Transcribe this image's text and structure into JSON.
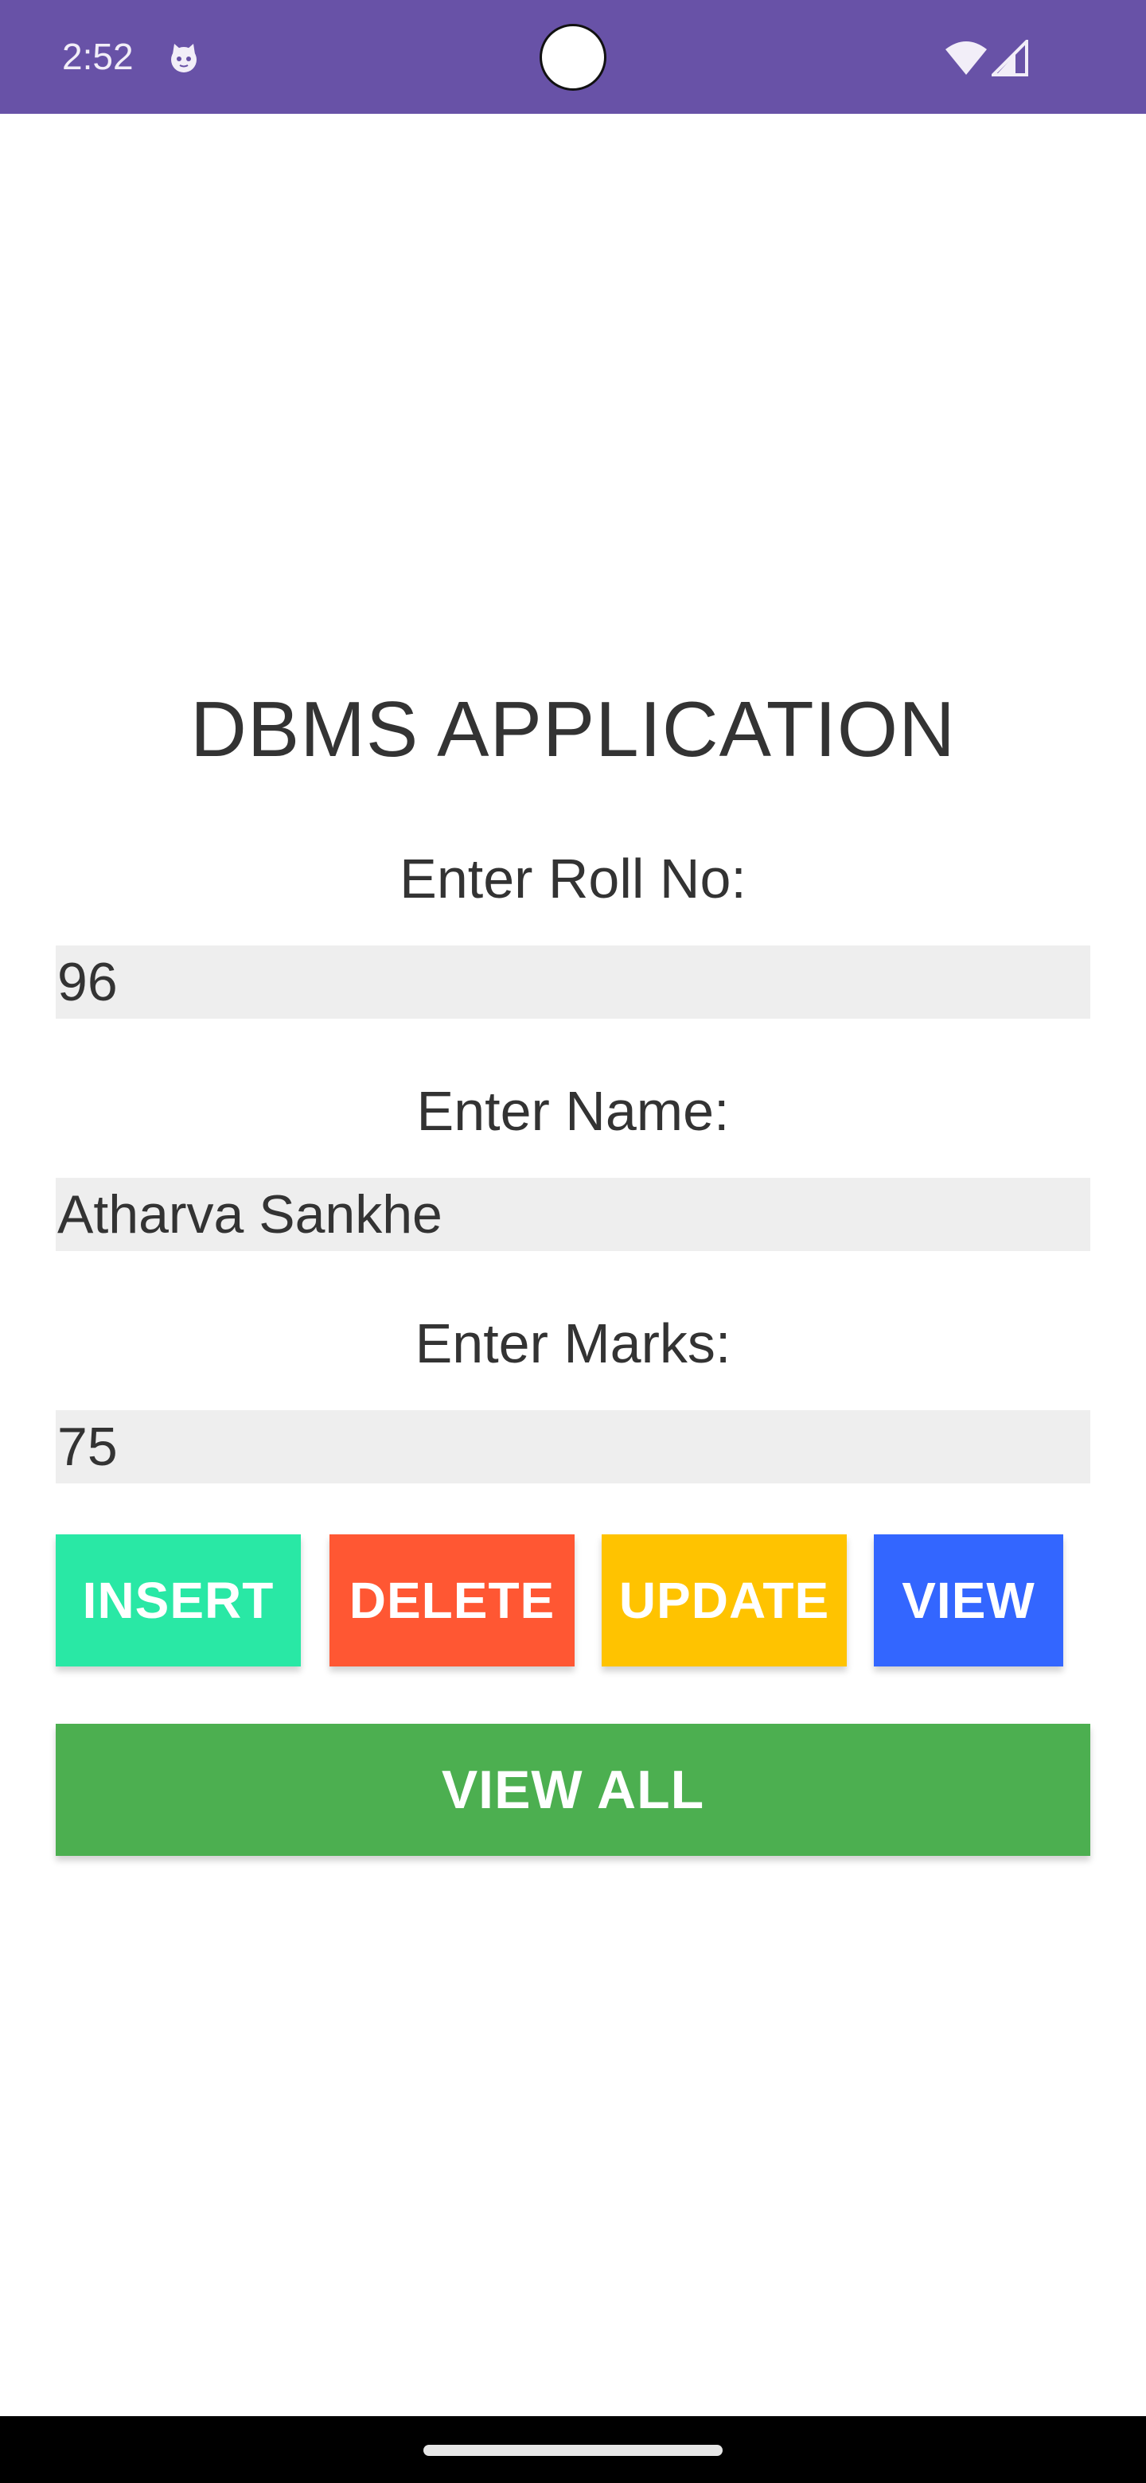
{
  "status_bar": {
    "time": "2:52",
    "background_color": "#6852a7",
    "icons": [
      "cat-notification-icon",
      "wifi-icon",
      "cellular-signal-icon"
    ]
  },
  "app": {
    "title": "DBMS APPLICATION",
    "fields": [
      {
        "label": "Enter Roll No:",
        "value": "96"
      },
      {
        "label": "Enter Name:",
        "value": "Atharva Sankhe"
      },
      {
        "label": "Enter Marks:",
        "value": "75"
      }
    ],
    "buttons": {
      "insert": {
        "label": "INSERT",
        "color": "#29e8a5"
      },
      "delete": {
        "label": "DELETE",
        "color": "#ff5733"
      },
      "update": {
        "label": "UPDATE",
        "color": "#ffc300"
      },
      "view": {
        "label": "VIEW",
        "color": "#3366ff"
      },
      "view_all": {
        "label": "VIEW ALL",
        "color": "#4caf50"
      }
    }
  }
}
